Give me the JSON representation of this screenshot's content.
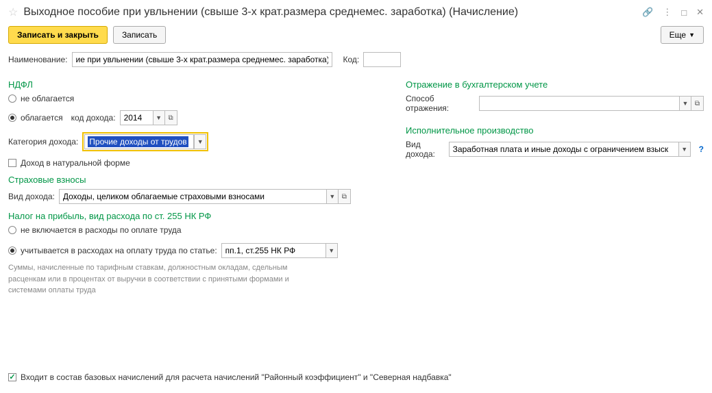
{
  "title": "Выходное пособие при увльнении (свыше 3-х крат.размера среднемес. заработка) (Начисление)",
  "toolbar": {
    "save_close": "Записать и закрыть",
    "save": "Записать",
    "more": "Еще"
  },
  "fields": {
    "name_label": "Наименование:",
    "name_value": "ие при увльнении (свыше 3-х крат.размера среднемес. заработка)",
    "code_label": "Код:",
    "code_value": ""
  },
  "ndfl": {
    "title": "НДФЛ",
    "opt_no_tax": "не облагается",
    "opt_tax": "облагается",
    "income_code_label": "код дохода:",
    "income_code_value": "2014",
    "category_label": "Категория дохода:",
    "category_value": "Прочие доходы от трудов",
    "natural_form": "Доход в натуральной форме"
  },
  "insurance": {
    "title": "Страховые взносы",
    "type_label": "Вид дохода:",
    "type_value": "Доходы, целиком облагаемые страховыми взносами"
  },
  "profit_tax": {
    "title": "Налог на прибыль, вид расхода по ст. 255 НК РФ",
    "opt_excluded": "не включается в расходы по оплате труда",
    "opt_included": "учитывается в расходах на оплату труда по статье:",
    "article_value": "пп.1, ст.255 НК РФ",
    "help": "Суммы, начисленные по тарифным ставкам, должностным окладам, сдельным расценкам или в процентах от выручки в соответствии с принятыми формами и системами оплаты труда"
  },
  "accounting": {
    "title": "Отражение в бухгалтерском учете",
    "method_label": "Способ отражения:",
    "method_value": ""
  },
  "enforcement": {
    "title": "Исполнительное производство",
    "type_label": "Вид дохода:",
    "type_value": "Заработная плата и иные доходы с ограничением взыск"
  },
  "footer": {
    "base_accrual": "Входит в состав базовых начислений для расчета начислений \"Районный коэффициент\" и \"Северная надбавка\""
  },
  "icons": {
    "help": "?",
    "dropdown": "▼",
    "open": "⧉"
  }
}
